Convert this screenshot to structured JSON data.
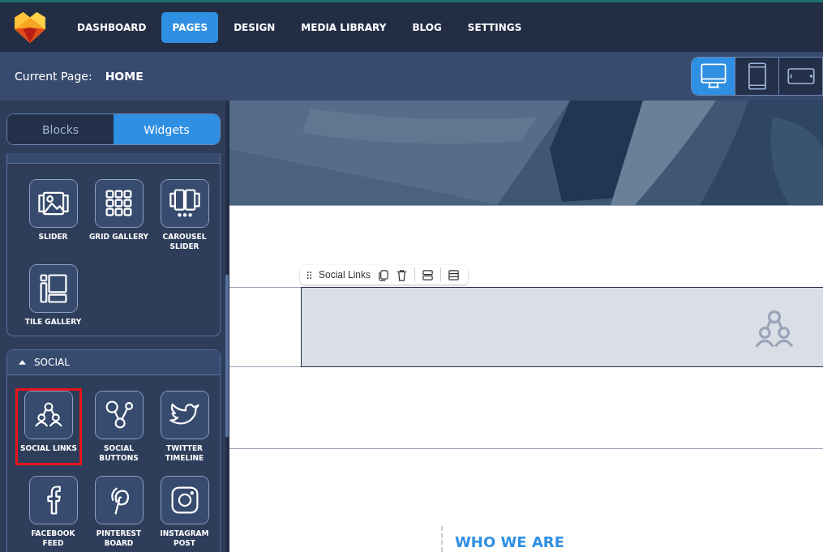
{
  "nav": {
    "items": [
      {
        "label": "DASHBOARD",
        "selected": false
      },
      {
        "label": "PAGES",
        "selected": true
      },
      {
        "label": "DESIGN",
        "selected": false
      },
      {
        "label": "MEDIA LIBRARY",
        "selected": false
      },
      {
        "label": "BLOG",
        "selected": false
      },
      {
        "label": "SETTINGS",
        "selected": false
      }
    ]
  },
  "current_page": {
    "label": "Current Page:",
    "value": "HOME"
  },
  "devices": [
    {
      "kind": "desktop",
      "selected": true
    },
    {
      "kind": "tablet",
      "selected": false
    },
    {
      "kind": "landscape",
      "selected": false
    }
  ],
  "sidebar": {
    "tabs": [
      {
        "label": "Blocks",
        "selected": false
      },
      {
        "label": "Widgets",
        "selected": true
      }
    ],
    "sections": [
      {
        "widgets": [
          {
            "kind": "slider",
            "label": "SLIDER",
            "highlighted": false
          },
          {
            "kind": "grid",
            "label": "GRID GALLERY",
            "highlighted": false
          },
          {
            "kind": "carousel",
            "label": "CAROUSEL SLIDER",
            "highlighted": false
          },
          {
            "kind": "tile",
            "label": "TILE GALLERY",
            "highlighted": false
          }
        ]
      },
      {
        "title": "SOCIAL",
        "expanded": true,
        "widgets": [
          {
            "kind": "social-links",
            "label": "SOCIAL LINKS",
            "highlighted": true
          },
          {
            "kind": "social-buttons",
            "label": "SOCIAL BUTTONS",
            "highlighted": false
          },
          {
            "kind": "twitter",
            "label": "TWITTER TIMELINE",
            "highlighted": false
          },
          {
            "kind": "facebook",
            "label": "FACEBOOK FEED",
            "highlighted": false
          },
          {
            "kind": "pinterest",
            "label": "PINTEREST BOARD",
            "highlighted": false
          },
          {
            "kind": "instagram",
            "label": "INSTAGRAM POST",
            "highlighted": false
          }
        ]
      }
    ]
  },
  "canvas": {
    "toolbar": {
      "label": "Social Links"
    },
    "heading": "WHO WE ARE"
  }
}
